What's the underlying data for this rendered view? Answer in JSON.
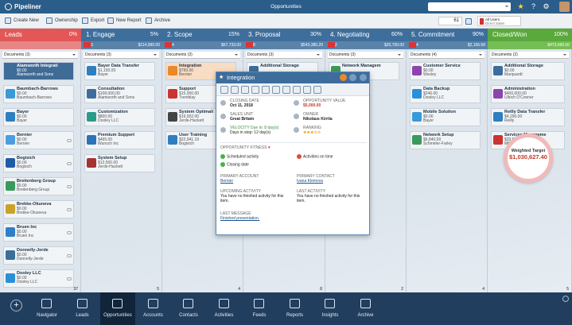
{
  "app": {
    "name": "Pipeliner",
    "title": "Opportunities"
  },
  "toolbar": {
    "create_new": "Create New",
    "ownership": "Ownership",
    "export": "Export",
    "new_report": "New Report",
    "archive": "Archive",
    "count": "61",
    "users_line1": "All Users",
    "users_line2": "Direct Sales"
  },
  "stages": [
    {
      "name": "Leads",
      "pct": "0%",
      "color": "#e35757",
      "sub_count": "",
      "sub_value": "",
      "sub_color": "#e88585"
    },
    {
      "name": "1. Engage",
      "pct": "5%",
      "color": "#3e6e9c",
      "sub_count": "3",
      "sub_value": "$114,990.00",
      "sub_color": "#5a83aa"
    },
    {
      "name": "2. Scope",
      "pct": "15%",
      "color": "#3e6e9c",
      "sub_count": "4",
      "sub_value": "$67,733.00",
      "sub_color": "#5a83aa"
    },
    {
      "name": "3. Proposal",
      "pct": "30%",
      "color": "#3e6e9c",
      "sub_count": "8",
      "sub_value": "$543,385.20",
      "sub_color": "#5a83aa"
    },
    {
      "name": "4. Negotiating",
      "pct": "60%",
      "color": "#3e6e9c",
      "sub_count": "2",
      "sub_value": "$20,700.00",
      "sub_color": "#5a83aa"
    },
    {
      "name": "5. Commitment",
      "pct": "90%",
      "color": "#3e6e9c",
      "sub_count": "4",
      "sub_value": "$2,106.58",
      "sub_color": "#5a83aa"
    },
    {
      "name": "Closed/Won",
      "pct": "100%",
      "color": "#5aa93c",
      "sub_count": "",
      "sub_value": "$473,690.00",
      "sub_color": "#75bd55"
    }
  ],
  "columns": [
    {
      "header": "Documents (3)",
      "footer": "37",
      "cards": [
        {
          "name": "Alamworth Integrati",
          "l1": "$0.00",
          "l2": "Alamworth and Sons",
          "color": "#3d6d9b",
          "sel": true
        },
        {
          "name": "Baumbach-Barrows",
          "l1": "$0.00",
          "l2": "Baumbach-Barrows",
          "color": "#3a9ad9"
        },
        {
          "name": "Bayer",
          "l1": "$0.00",
          "l2": "Bayer",
          "color": "#2d7fc1"
        },
        {
          "name": "Bernier",
          "l1": "$0.00",
          "l2": "Bernier",
          "color": "#4b9ee0"
        },
        {
          "name": "Bogisich",
          "l1": "$0.00",
          "l2": "Bogisich",
          "color": "#1e5aa8"
        },
        {
          "name": "Breitenberg Group",
          "l1": "$0.00",
          "l2": "Breitenberg Group",
          "color": "#3a9a5b"
        },
        {
          "name": "Brekke-Okuneva",
          "l1": "$0.00",
          "l2": "Brekke-Okuneva",
          "color": "#c9a227"
        },
        {
          "name": "Bruen Inc",
          "l1": "$0.00",
          "l2": "Bruen Inc",
          "color": "#2f7ec9"
        },
        {
          "name": "Donnelly-Jerde",
          "l1": "$0.00",
          "l2": "Donnelly-Jerde",
          "color": "#3d6d9b"
        },
        {
          "name": "Dooley LLC",
          "l1": "$0.00",
          "l2": "Dooley LLC",
          "color": "#2b8fd8"
        }
      ]
    },
    {
      "header": "Documents (3)",
      "footer": "5",
      "cards": [
        {
          "name": "Bayer Data Transfer",
          "l1": "$1,193.00",
          "l2": "Bayer",
          "color": "#2d7fc1"
        },
        {
          "name": "Consultation",
          "l1": "$108,000.00",
          "l2": "Alamworth and Sons",
          "color": "#3d6d9b"
        },
        {
          "name": "Customization",
          "l1": "$800.00",
          "l2": "Dooley LLC",
          "color": "#2b9b8b"
        },
        {
          "name": "Premium Support",
          "l1": "$495.00",
          "l2": "Wunsch Inc",
          "color": "#2c73b8"
        },
        {
          "name": "System Setup",
          "l1": "$12,500.00",
          "l2": "Jerde-Hackett",
          "color": "#a3342f"
        }
      ]
    },
    {
      "header": "Documents (3)",
      "footer": "4",
      "cards": [
        {
          "name": "Integration",
          "l1": "$790.00",
          "l2": "Bernier",
          "color": "#e8892b",
          "hi": true
        },
        {
          "name": "Support",
          "l1": "$15,000.00",
          "l2": "Tremblay",
          "color": "#c33"
        },
        {
          "name": "System Optimali",
          "l1": "$19,002.00",
          "l2": "Jerde-Hackett",
          "color": "#444"
        },
        {
          "name": "User Training",
          "l1": "$22,941.19",
          "l2": "Bogisich",
          "color": "#2d7fc1"
        }
      ]
    },
    {
      "header": "Documents (3)",
      "footer": "8",
      "cards": [
        {
          "name": "Additional Storage",
          "l1": "",
          "l2": "",
          "color": "#3d6d9b"
        }
      ]
    },
    {
      "header": "Documents (3)",
      "footer": "2",
      "cards": [
        {
          "name": "Network Managem",
          "l1": "",
          "l2": "",
          "color": "#3a9a5b"
        }
      ]
    },
    {
      "header": "Documents (4)",
      "footer": "4",
      "cards": [
        {
          "name": "Customer Service",
          "l1": "$0.00",
          "l2": "Wesley",
          "color": "#8e44ad"
        },
        {
          "name": "Data Backup",
          "l1": "$246.00",
          "l2": "Dooley LLC",
          "color": "#2b8fd8"
        },
        {
          "name": "Mobile Solution",
          "l1": "$0.00",
          "l2": "Bayer",
          "color": "#3a9ad9"
        },
        {
          "name": "Network Setup",
          "l1": "$6,840.00",
          "l2": "Schmeler-Farley",
          "color": "#3a9a5b"
        }
      ]
    },
    {
      "header": "Documents (2)",
      "footer": "5",
      "cards": [
        {
          "name": "Additional Storage",
          "l1": "$0.00",
          "l2": "Marquardt",
          "color": "#3d6d9b"
        },
        {
          "name": "Administration",
          "l1": "$400,000.00",
          "l2": "Ullrich O'Conner",
          "color": "#8e44ad"
        },
        {
          "name": "Reilly Data Transfer",
          "l1": "$4,290.00",
          "l2": "Reilly",
          "color": "#2d7fc1"
        },
        {
          "name": "Services Manageme",
          "l1": "$20,000.00",
          "l2": "Miller",
          "color": "#c33"
        }
      ]
    }
  ],
  "popup": {
    "title": "Integration",
    "closing_date_label": "CLOSING DATE",
    "closing_date": "Oct 11, 2018",
    "opp_value_label": "OPPORTUNITY VALUE",
    "opp_value": "$5,000.00",
    "sales_unit_label": "SALES UNIT",
    "sales_unit": "Great Britain",
    "owner_label": "OWNER",
    "owner": "Nikolaus Kirrila",
    "velocity_label": "VELOCITY Due in: 8 day(s)",
    "velocity": "Days in step: 12 day(s)",
    "ranking_label": "RANKING",
    "ranking": "★★★☆☆",
    "fitness_label": "OPPORTUNITY FITNESS",
    "fit1": "Scheduled activity",
    "fit2": "Activities on time",
    "fit3": "Closing date",
    "account_label": "PRIMARY ACCOUNT",
    "account": "Bernier",
    "contact_label": "PRIMARY CONTACT",
    "contact": "Ivana Klemova",
    "upcoming_label": "UPCOMING ACTIVITY",
    "upcoming": "You have no finished activity for this item.",
    "last_activity_label": "LAST ACTIVITY",
    "last_activity": "You have no finished activity for this item.",
    "last_message_label": "LAST MESSAGE",
    "last_message": "Finished presentation."
  },
  "target": {
    "label": "Weighted Target",
    "value": "$1,030,627.40"
  },
  "nav": [
    {
      "label": "Navigator",
      "key": "navigator"
    },
    {
      "label": "Leads",
      "key": "leads"
    },
    {
      "label": "Opportunities",
      "key": "opportunities",
      "active": true
    },
    {
      "label": "Accounts",
      "key": "accounts"
    },
    {
      "label": "Contacts",
      "key": "contacts"
    },
    {
      "label": "Activities",
      "key": "activities"
    },
    {
      "label": "Feeds",
      "key": "feeds"
    },
    {
      "label": "Reports",
      "key": "reports"
    },
    {
      "label": "Insights",
      "key": "insights"
    },
    {
      "label": "Archive",
      "key": "archive"
    }
  ],
  "colors": {
    "accent": "#2b5d8a",
    "leads": "#e35757",
    "won": "#5aa93c",
    "dock": "#223e5e"
  }
}
